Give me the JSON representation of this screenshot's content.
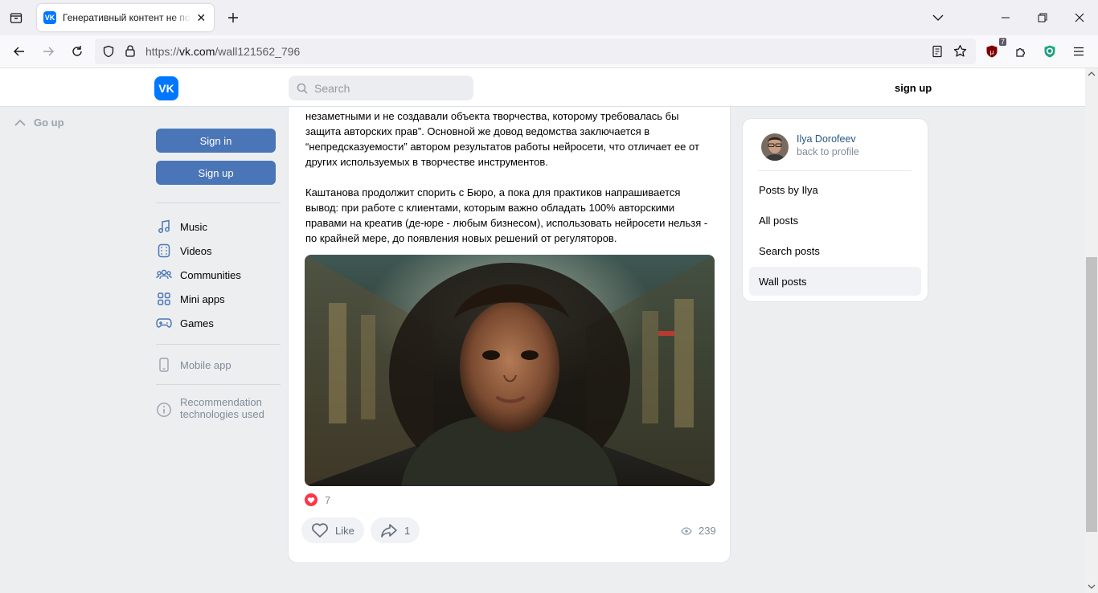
{
  "browser": {
    "tab_title": "Генеративный контент не подлежит защите",
    "tab_favicon": "VK",
    "url_prefix": "https://",
    "url_domain": "vk.com",
    "url_path": "/wall121562_796",
    "ublock_count": "7"
  },
  "header": {
    "logo": "VK",
    "search_placeholder": "Search",
    "signup_label": "sign up"
  },
  "left": {
    "go_up": "Go up",
    "signin_label": "Sign in",
    "signup_label": "Sign up",
    "menu": [
      {
        "label": "Music",
        "icon": "music-icon"
      },
      {
        "label": "Videos",
        "icon": "videos-icon"
      },
      {
        "label": "Communities",
        "icon": "communities-icon"
      },
      {
        "label": "Mini apps",
        "icon": "mini-apps-icon"
      },
      {
        "label": "Games",
        "icon": "games-icon"
      }
    ],
    "mobile_app": "Mobile app",
    "recommendation_line1": "Recommendation",
    "recommendation_line2": "technologies used"
  },
  "post": {
    "para1_line1": "незаметными и не создавали объекта творчества, которому требовалась бы",
    "para1_line2": "защита авторских прав”. Основной же довод ведомства заключается в",
    "para1_line3": "“непредсказуемости” автором результатов работы нейросети, что отличает ее от",
    "para1_line4": "других используемых в творчестве инструментов.",
    "para2_line1": "Каштанова продолжит спорить с Бюро, а пока для практиков напрашивается",
    "para2_line2": "вывод: при работе с клиентами, которым важно обладать 100% авторскими",
    "para2_line3": "правами на креатив (де-юре - любым бизнесом), использовать нейросети нельзя -",
    "para2_line4": "по крайней мере, до появления новых решений от регуляторов.",
    "reaction_count": "7",
    "like_label": "Like",
    "share_count": "1",
    "views": "239"
  },
  "sidebar_card": {
    "owner_name": "Ilya Dorofeev",
    "owner_sub": "back to profile",
    "items": [
      {
        "label": "Posts by Ilya",
        "active": false
      },
      {
        "label": "All posts",
        "active": false
      },
      {
        "label": "Search posts",
        "active": false
      },
      {
        "label": "Wall posts",
        "active": true
      }
    ]
  },
  "colors": {
    "accent": "#0077ff",
    "button": "#4a76b7",
    "page_bg": "#edeef0",
    "like_red": "#ff3347",
    "link": "#2a5885"
  }
}
